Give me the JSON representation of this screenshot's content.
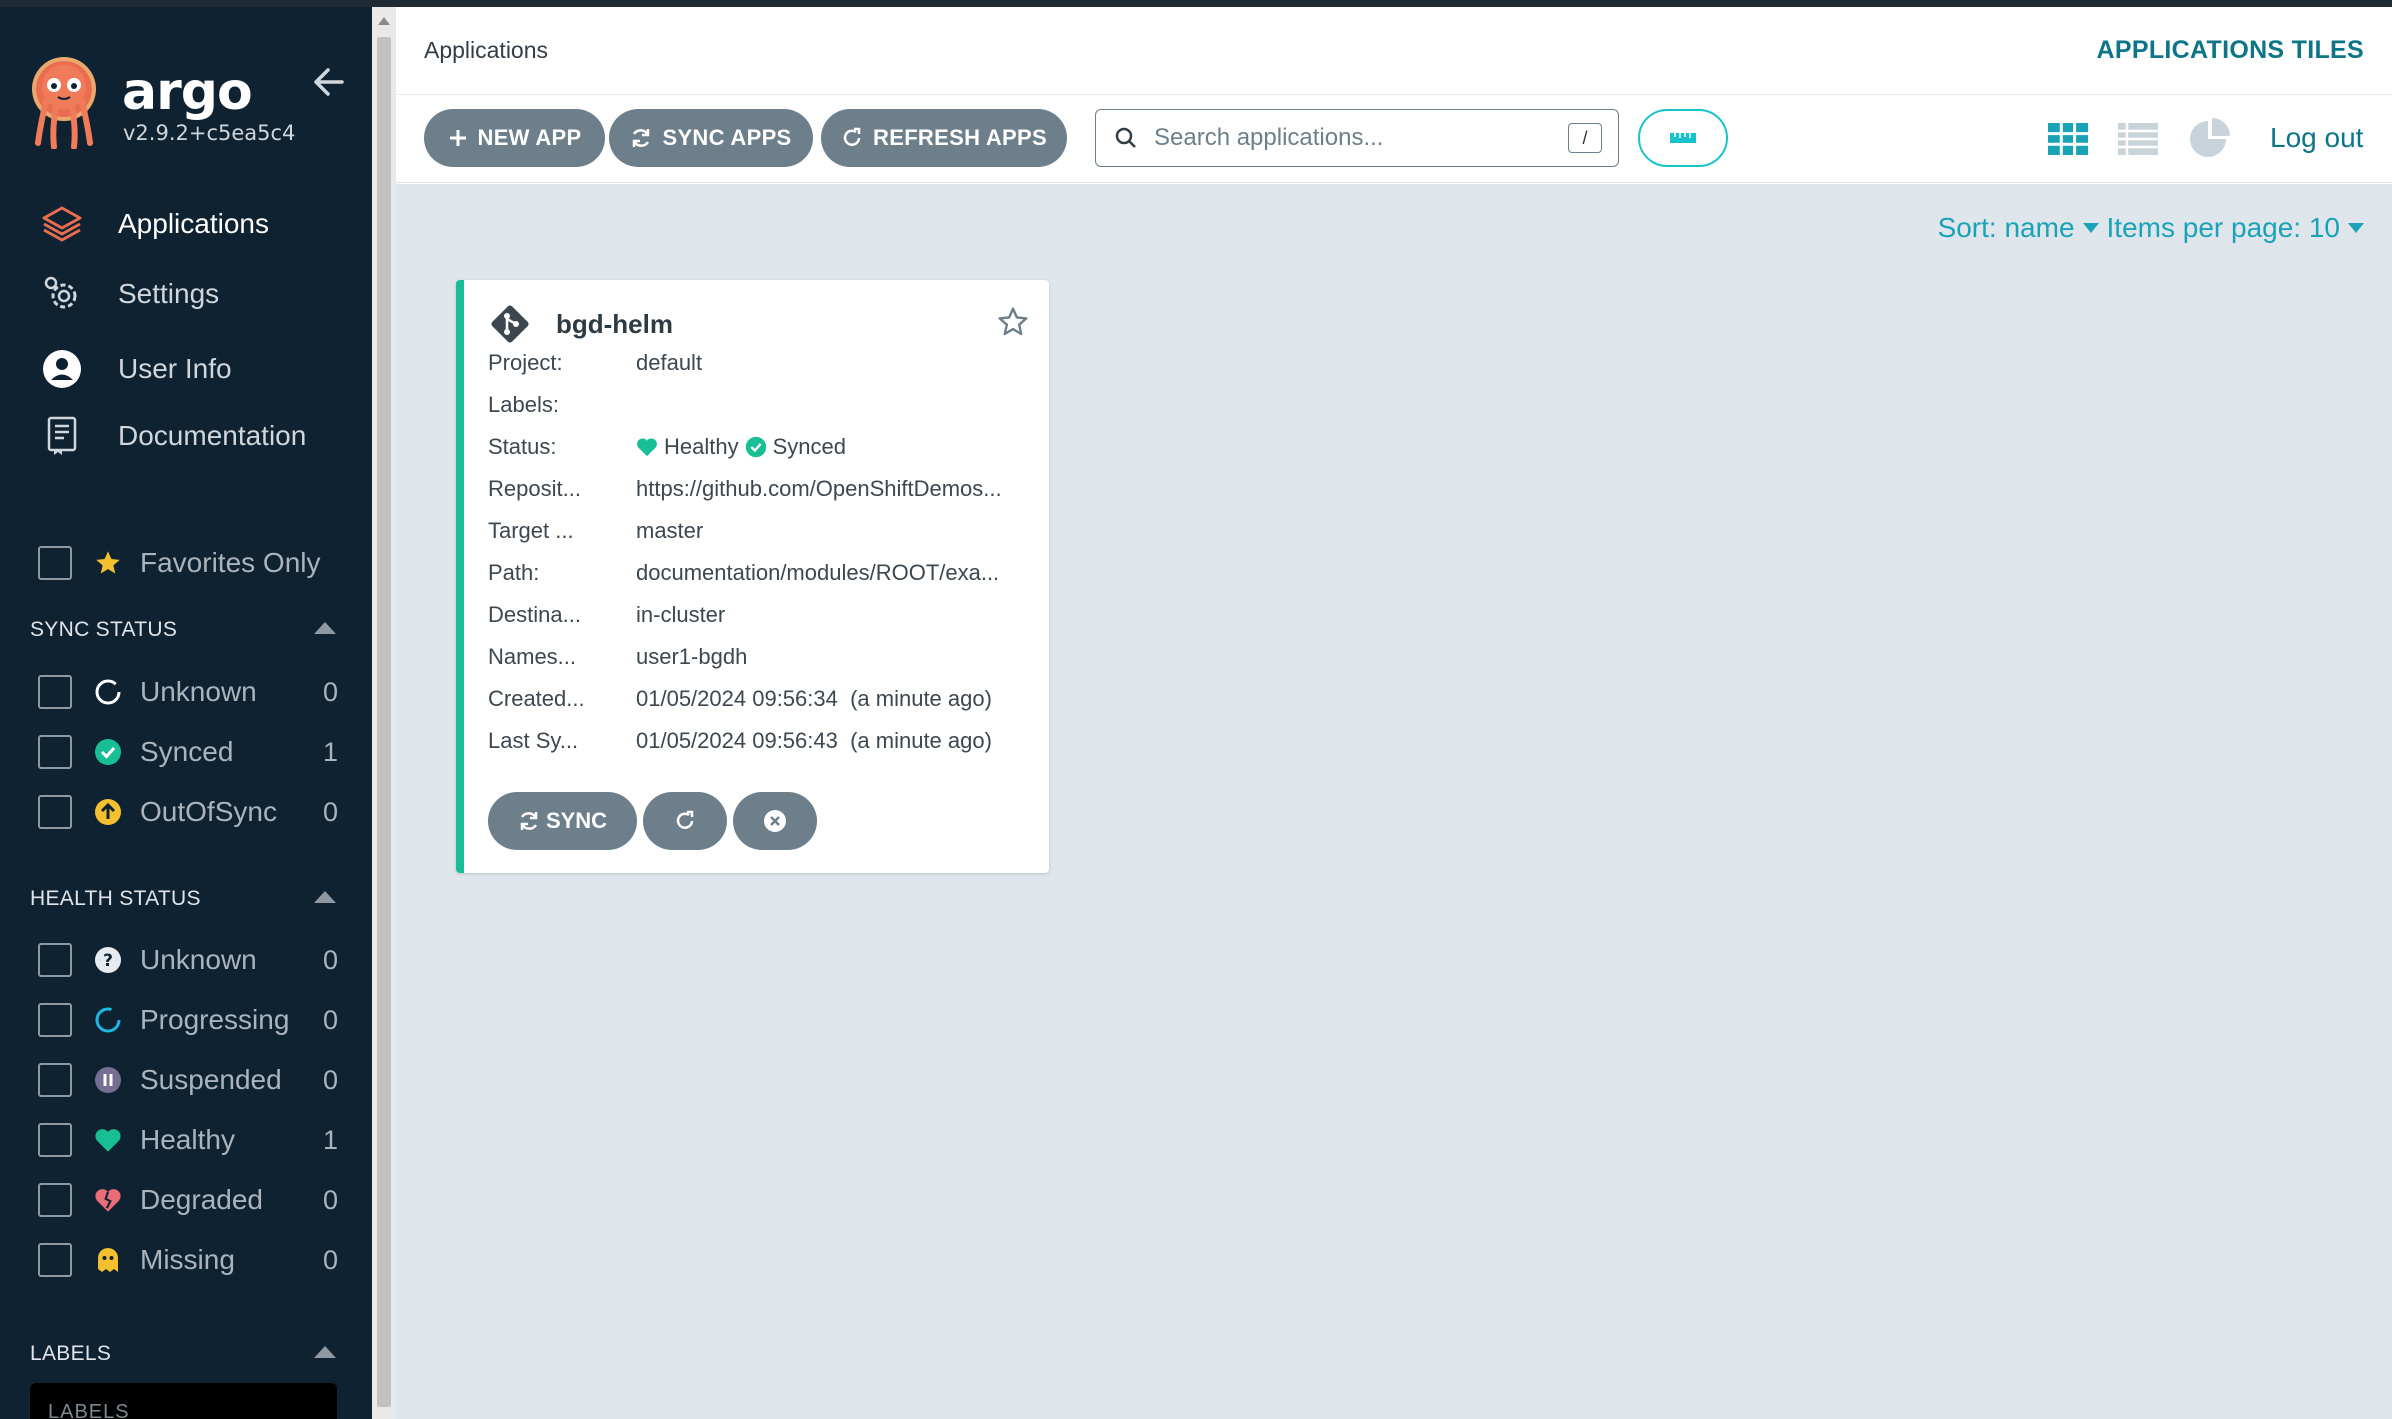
{
  "brand": {
    "name": "argo",
    "version": "v2.9.2+c5ea5c4"
  },
  "nav": [
    {
      "label": "Applications",
      "icon": "layers-icon",
      "active": true
    },
    {
      "label": "Settings",
      "icon": "gear-icon"
    },
    {
      "label": "User Info",
      "icon": "user-icon"
    },
    {
      "label": "Documentation",
      "icon": "book-icon"
    }
  ],
  "filters": {
    "favorites_label": "Favorites Only",
    "sync_title": "SYNC STATUS",
    "sync": [
      {
        "label": "Unknown",
        "count": "0"
      },
      {
        "label": "Synced",
        "count": "1"
      },
      {
        "label": "OutOfSync",
        "count": "0"
      }
    ],
    "health_title": "HEALTH STATUS",
    "health": [
      {
        "label": "Unknown",
        "count": "0"
      },
      {
        "label": "Progressing",
        "count": "0"
      },
      {
        "label": "Suspended",
        "count": "0"
      },
      {
        "label": "Healthy",
        "count": "1"
      },
      {
        "label": "Degraded",
        "count": "0"
      },
      {
        "label": "Missing",
        "count": "0"
      }
    ],
    "labels_title": "LABELS",
    "labels_placeholder": "LABELS"
  },
  "header": {
    "title": "Applications",
    "view_title": "APPLICATIONS TILES"
  },
  "toolbar": {
    "new_app": "NEW APP",
    "sync_apps": "SYNC APPS",
    "refresh_apps": "REFRESH APPS",
    "search_placeholder": "Search applications...",
    "search_shortcut": "/",
    "logout": "Log out"
  },
  "sort": {
    "sort_label": "Sort: name",
    "per_page_label": "Items per page: 10"
  },
  "app": {
    "name": "bgd-helm",
    "rows": [
      {
        "key": "Project:",
        "value": "default"
      },
      {
        "key": "Labels:",
        "value": ""
      },
      {
        "key": "Status:",
        "health": "Healthy",
        "sync": "Synced"
      },
      {
        "key": "Reposit...",
        "value": "https://github.com/OpenShiftDemos..."
      },
      {
        "key": "Target ...",
        "value": "master"
      },
      {
        "key": "Path:",
        "value": "documentation/modules/ROOT/exa..."
      },
      {
        "key": "Destina...",
        "value": "in-cluster"
      },
      {
        "key": "Names...",
        "value": "user1-bgdh"
      },
      {
        "key": "Created...",
        "value": "01/05/2024 09:56:34  (a minute ago)"
      },
      {
        "key": "Last Sy...",
        "value": "01/05/2024 09:56:43  (a minute ago)"
      }
    ],
    "sync_button": "SYNC"
  },
  "colors": {
    "sidebar_bg": "#0f2231",
    "accent": "#0d7587",
    "healthy": "#18be94",
    "button": "#6d7f8b",
    "main_bg": "#dee6ec"
  }
}
